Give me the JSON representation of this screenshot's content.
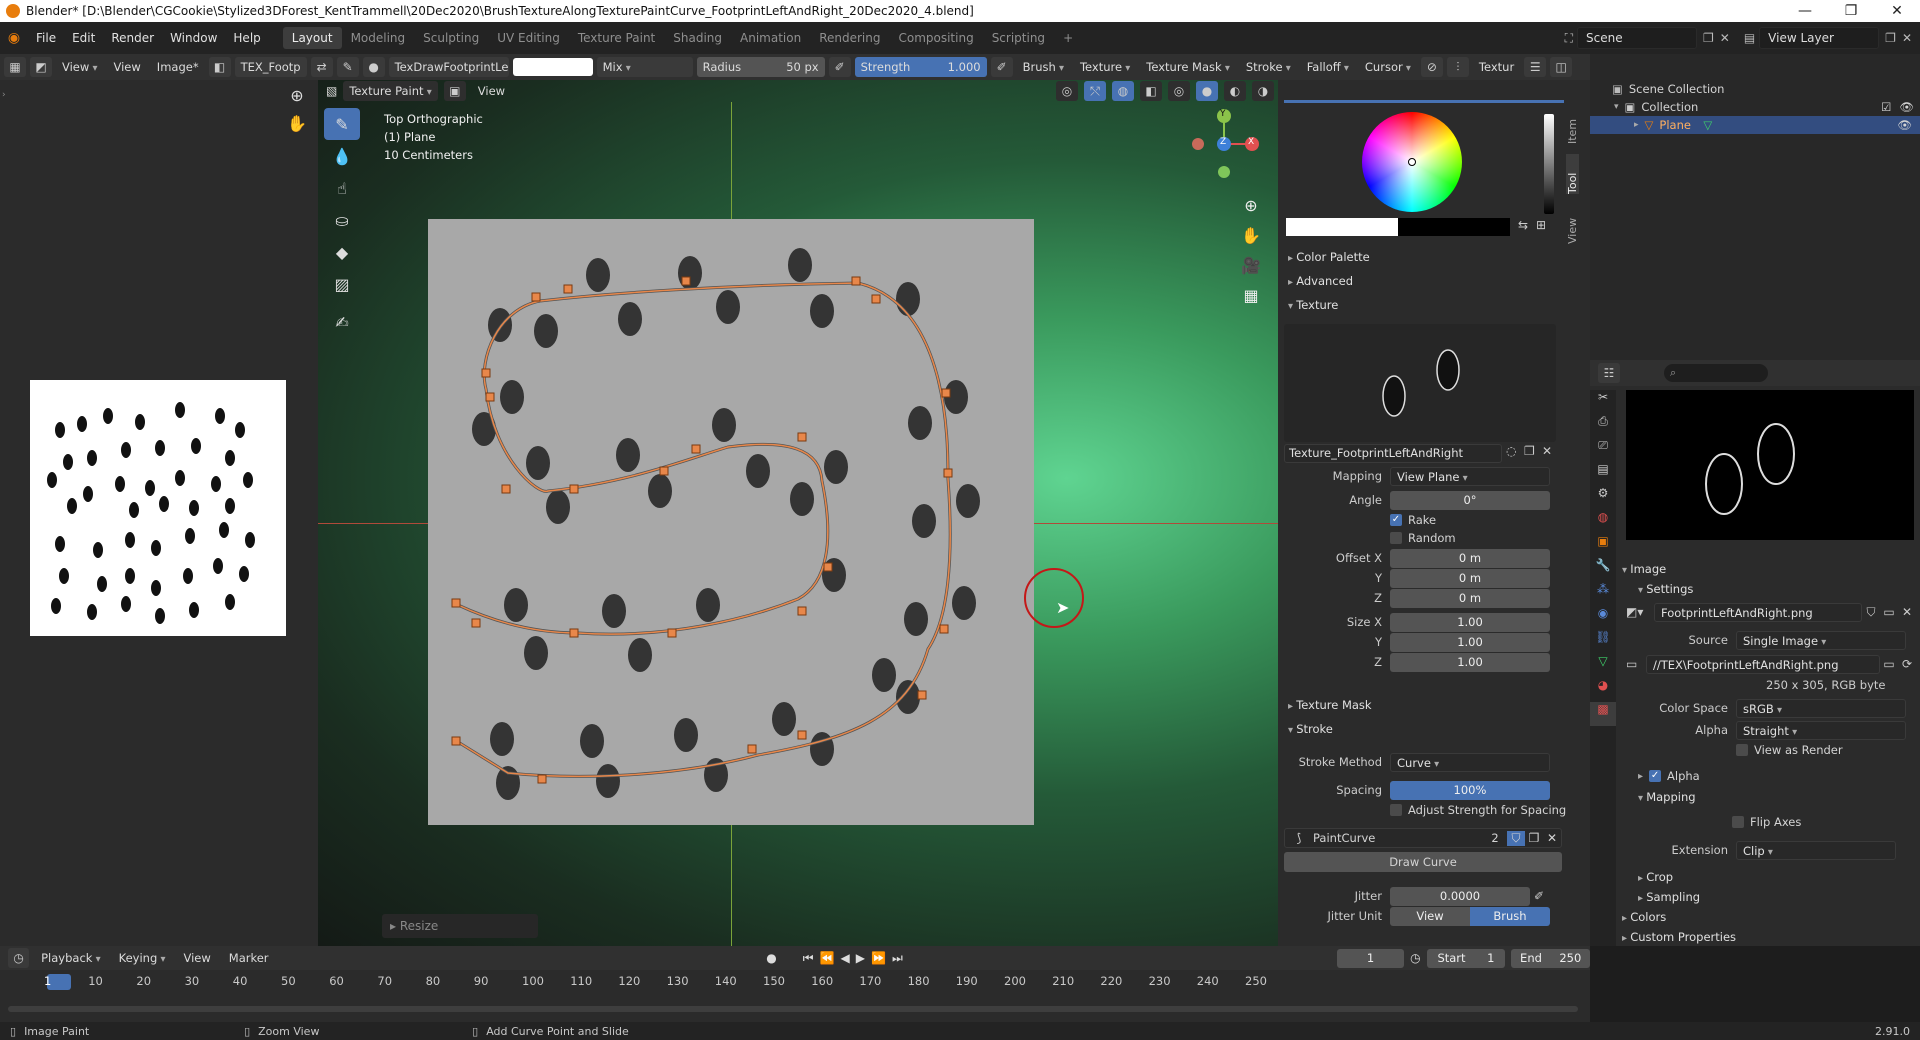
{
  "window": {
    "title": "Blender* [D:\\Blender\\CGCookie\\Stylized3DForest_KentTrammell\\20Dec2020\\BrushTextureAlongTexturePaintCurve_FootprintLeftAndRight_20Dec2020_4.blend]",
    "minimize": "—",
    "maximize": "❐",
    "close": "✕"
  },
  "menu": {
    "items": [
      "File",
      "Edit",
      "Render",
      "Window",
      "Help"
    ]
  },
  "workspaces": [
    "Layout",
    "Modeling",
    "Sculpting",
    "UV Editing",
    "Texture Paint",
    "Shading",
    "Animation",
    "Rendering",
    "Compositing",
    "Scripting",
    "+"
  ],
  "workspace_active": "Layout",
  "scene": {
    "label": "Scene",
    "view_layer": "View Layer"
  },
  "toolhdr": {
    "view": "View",
    "view2": "View",
    "image": "Image*",
    "image_name": "TEX_Footp",
    "brush_name": "TexDrawFootprintLe...",
    "blend": "Mix",
    "radius_label": "Radius",
    "radius_value": "50 px",
    "strength_label": "Strength",
    "strength_value": "1.000",
    "menus": [
      "Brush",
      "Texture",
      "Texture Mask",
      "Stroke",
      "Falloff",
      "Cursor"
    ],
    "texture_trunc": "Textur"
  },
  "viewport": {
    "mode": "Texture Paint",
    "view": "View",
    "overlay_line1": "Top Orthographic",
    "overlay_line2": "(1) Plane",
    "overlay_line3": "10 Centimeters",
    "resize": "Resize",
    "gizmo": {
      "y": "Y",
      "z": "Z",
      "x": "X"
    }
  },
  "npanel": {
    "tabs": [
      "Item",
      "Tool",
      "View"
    ],
    "sections": {
      "color_palette": "Color Palette",
      "advanced": "Advanced",
      "texture": "Texture",
      "texture_mask": "Texture Mask",
      "stroke": "Stroke"
    },
    "texture_name": "Texture_FootprintLeftAndRight",
    "mapping_label": "Mapping",
    "mapping_value": "View Plane",
    "angle_label": "Angle",
    "angle_value": "0°",
    "rake": "Rake",
    "random": "Random",
    "offset_x_label": "Offset X",
    "offset_y_label": "Y",
    "offset_z_label": "Z",
    "offset_x": "0 m",
    "offset_y": "0 m",
    "offset_z": "0 m",
    "size_x_label": "Size X",
    "size_y_label": "Y",
    "size_z_label": "Z",
    "size_x": "1.00",
    "size_y": "1.00",
    "size_z": "1.00",
    "stroke_method_label": "Stroke Method",
    "stroke_method": "Curve",
    "spacing_label": "Spacing",
    "spacing_value": "100%",
    "adjust_strength": "Adjust Strength for Spacing",
    "paint_curve": "PaintCurve",
    "paint_curve_users": "2",
    "draw_curve": "Draw Curve",
    "jitter_label": "Jitter",
    "jitter_value": "0.0000",
    "jitter_unit_label": "Jitter Unit",
    "jitter_unit_view": "View",
    "jitter_unit_brush": "Brush",
    "spacing_fraction": 1.0
  },
  "outliner": {
    "scene_collection": "Scene Collection",
    "collection": "Collection",
    "plane": "Plane"
  },
  "props": {
    "image_section": "Image",
    "settings": "Settings",
    "image_name": "FootprintLeftAndRight.png",
    "source_label": "Source",
    "source_value": "Single Image",
    "filepath": "//TEX\\FootprintLeftAndRight.png",
    "info": "250 x 305,  RGB byte",
    "color_space_label": "Color Space",
    "color_space": "sRGB",
    "alpha_label": "Alpha",
    "alpha_value": "Straight",
    "view_as_render": "View as Render",
    "alpha_section": "Alpha",
    "mapping_section": "Mapping",
    "flip_axes": "Flip Axes",
    "extension_label": "Extension",
    "extension_value": "Clip",
    "crop": "Crop",
    "sampling": "Sampling",
    "colors": "Colors",
    "custom_props": "Custom Properties"
  },
  "timeline": {
    "menus": [
      "Playback",
      "Keying",
      "View",
      "Marker"
    ],
    "current_frame": "1",
    "start_label": "Start",
    "start": "1",
    "end_label": "End",
    "end": "250",
    "ticks": [
      "1",
      "10",
      "20",
      "30",
      "40",
      "50",
      "60",
      "70",
      "80",
      "90",
      "100",
      "110",
      "120",
      "130",
      "140",
      "150",
      "160",
      "170",
      "180",
      "190",
      "200",
      "210",
      "220",
      "230",
      "240",
      "250"
    ]
  },
  "statusbar": {
    "left": "Image Paint",
    "mid": "Zoom View",
    "right_action": "Add Curve Point and Slide",
    "version": "2.91.0"
  },
  "colors": {
    "accent": "#4772b3",
    "curve": "#e8874a",
    "brand": "#e87d0d"
  }
}
